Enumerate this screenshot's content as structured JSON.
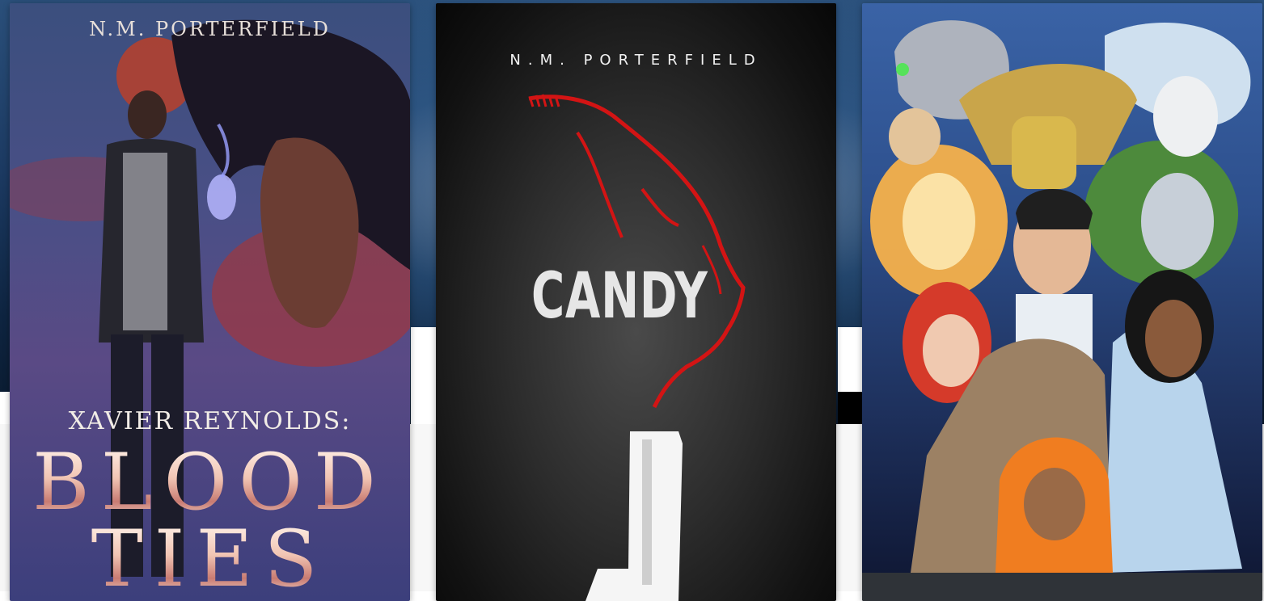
{
  "books": [
    {
      "author": "N.M. PORTERFIELD",
      "subtitle": "XAVIER REYNOLDS:",
      "title_line1": "BLOOD",
      "title_line2": "TIES"
    },
    {
      "author": "N.M. PORTERFIELD",
      "title": "CANDY"
    },
    {
      "cover_art": "anime-style superhero ensemble cover"
    }
  ],
  "colors": {
    "card1_title": "#f2d7cc",
    "card2_accent_red": "#d31414",
    "card3_sky": "#3a63a6"
  }
}
